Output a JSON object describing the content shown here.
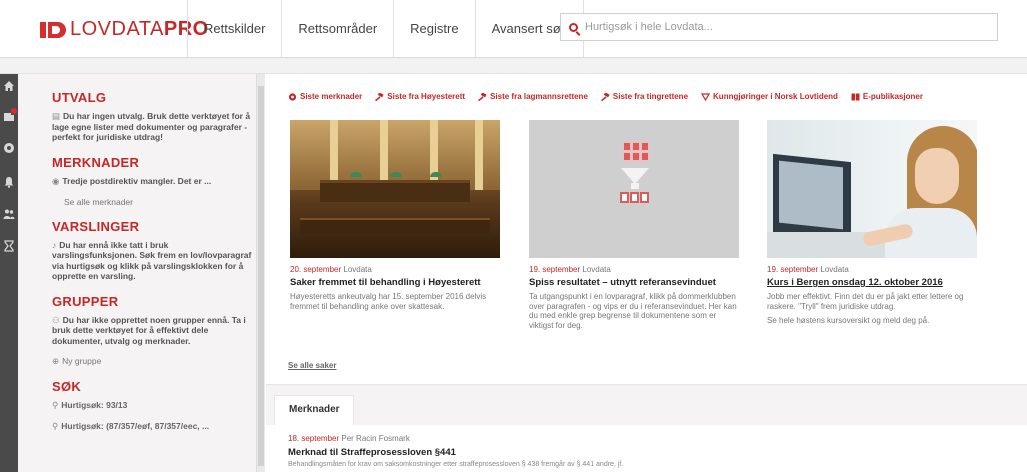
{
  "header": {
    "logo_text_light": "LOVDATA",
    "logo_text_bold": "PRO",
    "nav": [
      "Rettskilder",
      "Rettsområder",
      "Registre",
      "Avansert søk"
    ],
    "search_placeholder": "Hurtigsøk i hele Lovdata..."
  },
  "rail": {
    "icons": [
      "home-icon",
      "basket-icon",
      "comment-icon",
      "bell-icon",
      "users-icon",
      "hourglass-icon"
    ]
  },
  "sidebar": {
    "utvalg": {
      "title": "UTVALG",
      "text": "Du har ingen utvalg. Bruk dette verktøyet for å lage egne lister med dokumenter og paragrafer - perfekt for juridiske utdrag!"
    },
    "merknader": {
      "title": "MERKNADER",
      "item": "Tredje postdirektiv mangler. Det er ...",
      "see_all": "Se alle merknader"
    },
    "varslinger": {
      "title": "VARSLINGER",
      "text": "Du har ennå ikke tatt i bruk varslingsfunksjonen. Søk frem en lov/lovparagraf via hurtigsøk og klikk på varslingsklokken for å opprette en varsling."
    },
    "grupper": {
      "title": "GRUPPER",
      "text": "Du har ikke opprettet noen grupper ennå. Ta i bruk dette verktøyet for å effektivt dele dokumenter, utvalg og merknader.",
      "new_group": "Ny gruppe"
    },
    "sok": {
      "title": "SØK",
      "items": [
        "Hurtigsøk: 93/13",
        "Hurtigsøk: (87/357/eøf, 87/357/eec, ..."
      ]
    }
  },
  "main": {
    "tabs": [
      "Siste merknader",
      "Siste fra Høyesterett",
      "Siste fra lagmannsrettene",
      "Siste fra tingrettene",
      "Kunngjøringer i Norsk Lovtidend",
      "E-publikasjoner"
    ],
    "cards": [
      {
        "date": "20. september",
        "source": "Lovdata",
        "title": "Saker fremmet til behandling i Høyesterett",
        "desc": "Høyesteretts ankeutvalg har 15. september 2016 delvis fremmet til behandling anke over skattesak."
      },
      {
        "date": "19. september",
        "source": "Lovdata",
        "title": "Spiss resultatet – utnytt referansevinduet",
        "desc": "Ta utgangspunkt i en lovparagraf, klikk på dommerklubben over paragrafen - og vips er du i referansevinduet. Her kan du med enkle grep begrense til dokumentene som er viktigst for deg."
      },
      {
        "date": "19. september",
        "source": "Lovdata",
        "title": "Kurs i Bergen onsdag 12. oktober 2016",
        "desc": "Jobb mer effektivt. Finn det du er på jakt etter lettere og raskere. \"Tryll\" frem juridiske utdrag.",
        "desc2": "Se hele høstens kursoversikt og meld deg på."
      }
    ],
    "see_all_cases": "Se alle saker",
    "merknader_tab": "Merknader",
    "merknad": {
      "date": "18. september",
      "author": "Per Racin Fosmark",
      "title": "Merknad til Straffeprosessloven §441",
      "desc": "Behandlingsmåten for krav om saksomkostninger etter straffeprosessloven § 438 fremgår av § 441 andre, jf."
    }
  },
  "colors": {
    "accent": "#c62828",
    "sidebar_bg": "#f5f3f3",
    "rail_bg": "#4a4a4a"
  }
}
